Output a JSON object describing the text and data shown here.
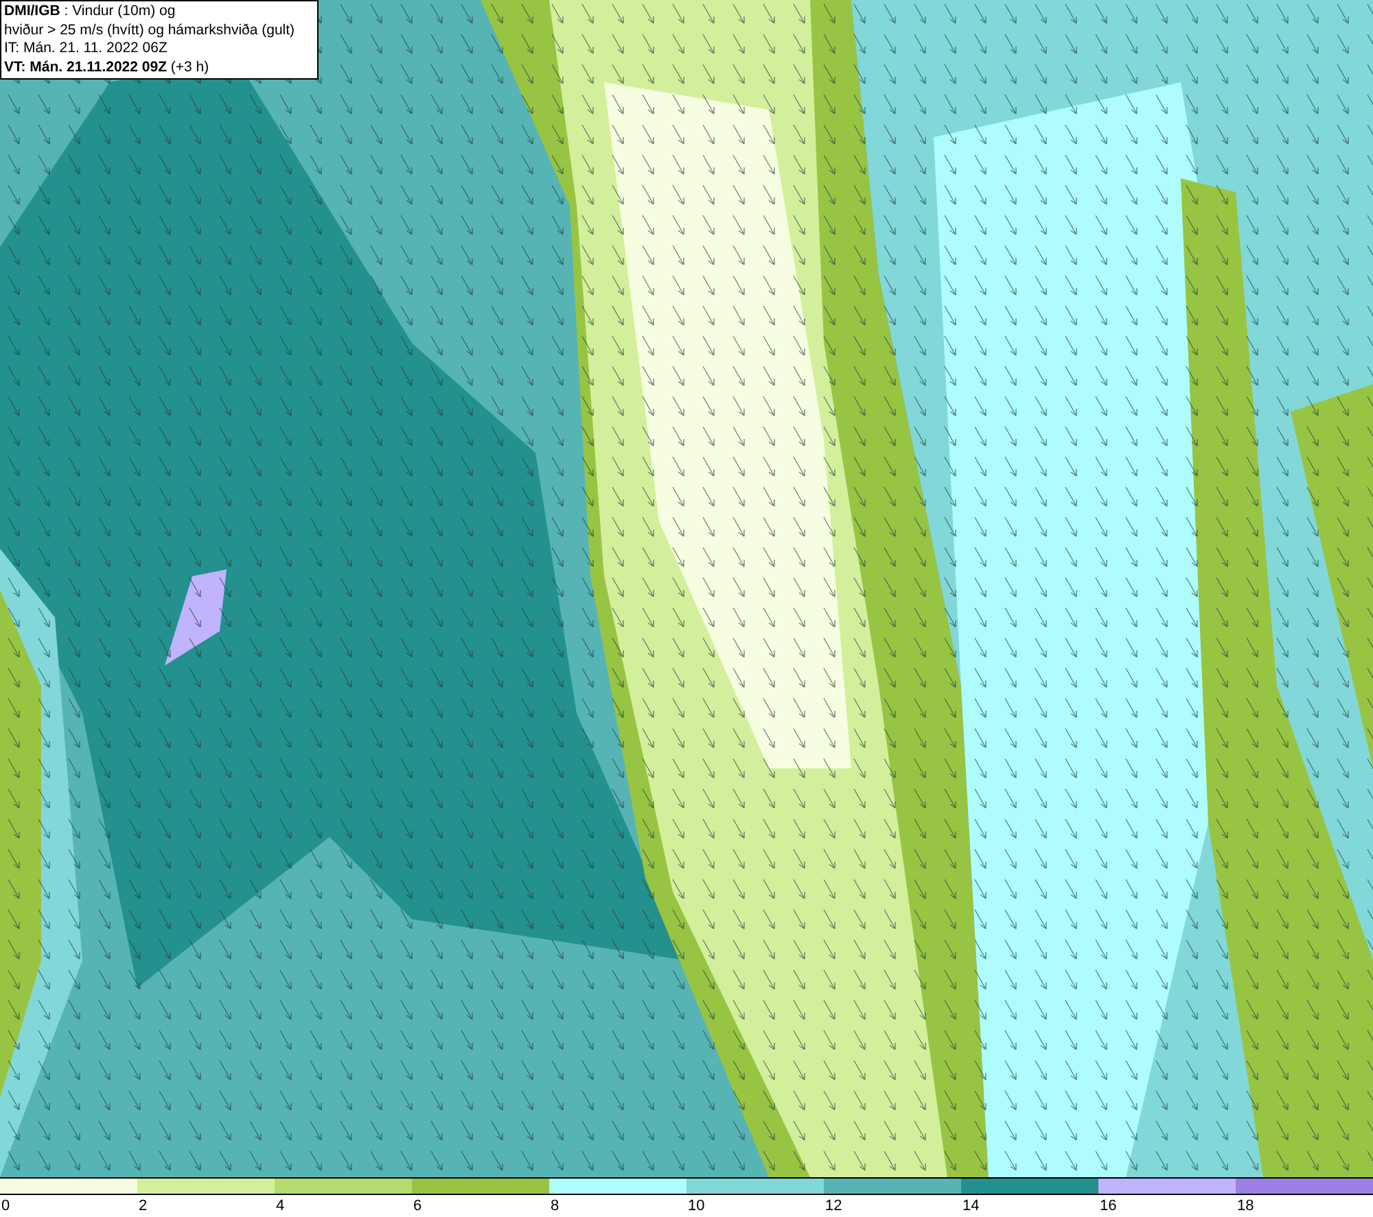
{
  "info_box": {
    "lines": [
      "**DMI/IGB** : Vindur (10m) og",
      "hviður > 25 m/s (hvítt) og hámarkshviða (gult)",
      "IT: Mán. 21. 11. 2022 06Z",
      "**VT: Mán. 21.11.2022 09Z** (+3 h)"
    ]
  },
  "legend": {
    "segments": [
      {
        "color": "#f7fde0"
      },
      {
        "color": "#d4ef9c"
      },
      {
        "color": "#b4db70"
      },
      {
        "color": "#98c444"
      },
      {
        "color": "#aefcfc"
      },
      {
        "color": "#82d8d8"
      },
      {
        "color": "#56b4b4"
      },
      {
        "color": "#24918e"
      },
      {
        "color": "#c0b4fc"
      },
      {
        "color": "#9c80e4"
      }
    ],
    "labels": [
      "0",
      "2",
      "4",
      "6",
      "8",
      "10",
      "12",
      "14",
      "16",
      "18"
    ]
  }
}
